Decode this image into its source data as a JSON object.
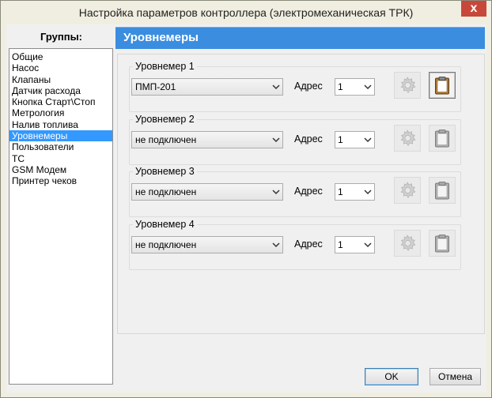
{
  "window": {
    "title": "Настройка параметров контроллера (электромеханическая ТРК)",
    "close_glyph": "x"
  },
  "groups": {
    "label": "Группы:",
    "items": [
      {
        "label": "Общие"
      },
      {
        "label": "Насос"
      },
      {
        "label": "Клапаны"
      },
      {
        "label": "Датчик расхода"
      },
      {
        "label": "Кнопка Старт\\Стоп"
      },
      {
        "label": "Метрология"
      },
      {
        "label": "Налив топлива"
      },
      {
        "label": "Уровнемеры",
        "selected": true
      },
      {
        "label": "Пользователи"
      },
      {
        "label": "ТС"
      },
      {
        "label": "GSM Модем"
      },
      {
        "label": "Принтер чеков"
      }
    ]
  },
  "header": {
    "title": "Уровнемеры"
  },
  "gauges": [
    {
      "title": "Уровнемер 1",
      "type": "ПМП-201",
      "address_label": "Адрес",
      "address": "1",
      "settings_enabled": false,
      "clipboard_active": true
    },
    {
      "title": "Уровнемер 2",
      "type": "не подключен",
      "address_label": "Адрес",
      "address": "1",
      "settings_enabled": false,
      "clipboard_active": false
    },
    {
      "title": "Уровнемер 3",
      "type": "не подключен",
      "address_label": "Адрес",
      "address": "1",
      "settings_enabled": false,
      "clipboard_active": false
    },
    {
      "title": "Уровнемер 4",
      "type": "не подключен",
      "address_label": "Адрес",
      "address": "1",
      "settings_enabled": false,
      "clipboard_active": false
    }
  ],
  "footer": {
    "ok_label": "OK",
    "cancel_label": "Отмена"
  }
}
